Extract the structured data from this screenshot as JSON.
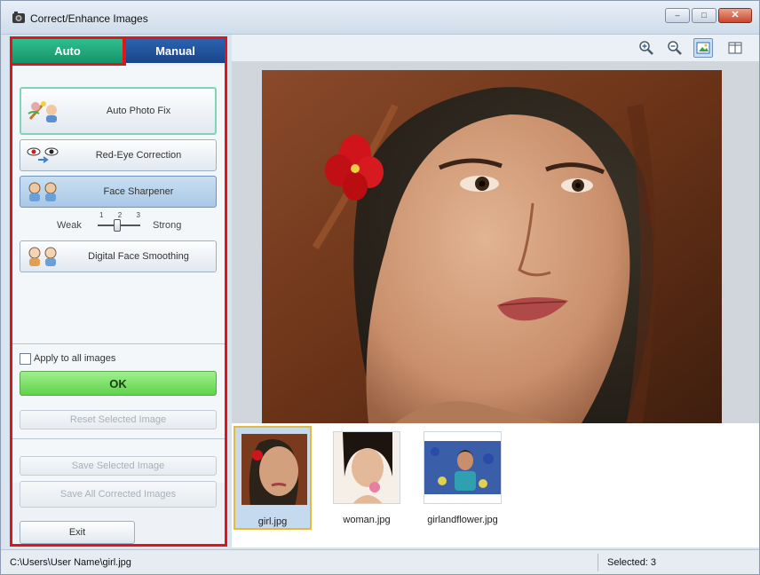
{
  "window": {
    "title": "Correct/Enhance Images",
    "controls": {
      "minimize": "–",
      "maximize": "□",
      "close": "✕"
    }
  },
  "tabs": [
    {
      "label": "Auto",
      "active": true,
      "color": "#16936a"
    },
    {
      "label": "Manual",
      "active": false,
      "color": "#1a4588"
    }
  ],
  "tools": {
    "auto_photo_fix": {
      "label": "Auto Photo Fix",
      "icon": "auto-photo-fix-icon"
    },
    "red_eye": {
      "label": "Red-Eye Correction",
      "icon": "red-eye-icon"
    },
    "face_sharpener": {
      "label": "Face Sharpener",
      "icon": "face-sharpener-icon",
      "selected": true
    },
    "slider": {
      "weak_label": "Weak",
      "strong_label": "Strong",
      "ticks": [
        "1",
        "2",
        "3"
      ],
      "value": 2
    },
    "digital_face_smoothing": {
      "label": "Digital Face Smoothing",
      "icon": "face-smoothing-icon"
    }
  },
  "apply_all": {
    "label": "Apply to all images",
    "checked": false
  },
  "buttons": {
    "ok": "OK",
    "reset": "Reset Selected Image",
    "save_selected": "Save Selected Image",
    "save_all": "Save All Corrected Images",
    "exit": "Exit"
  },
  "toolbar": [
    {
      "name": "zoom-in-icon"
    },
    {
      "name": "zoom-out-icon"
    },
    {
      "name": "whole-image-view-icon",
      "active": true
    },
    {
      "name": "compare-view-icon"
    }
  ],
  "thumbnails": [
    {
      "label": "girl.jpg",
      "selected": true
    },
    {
      "label": "woman.jpg",
      "selected": false
    },
    {
      "label": "girlandflower.jpg",
      "selected": false
    }
  ],
  "status": {
    "path": "C:\\Users\\User Name\\girl.jpg",
    "selected": "Selected: 3"
  },
  "colors": {
    "highlight_border": "#e0151b",
    "ok_green": "#5fd24b",
    "selected_thumb_border": "#e6b93a"
  }
}
